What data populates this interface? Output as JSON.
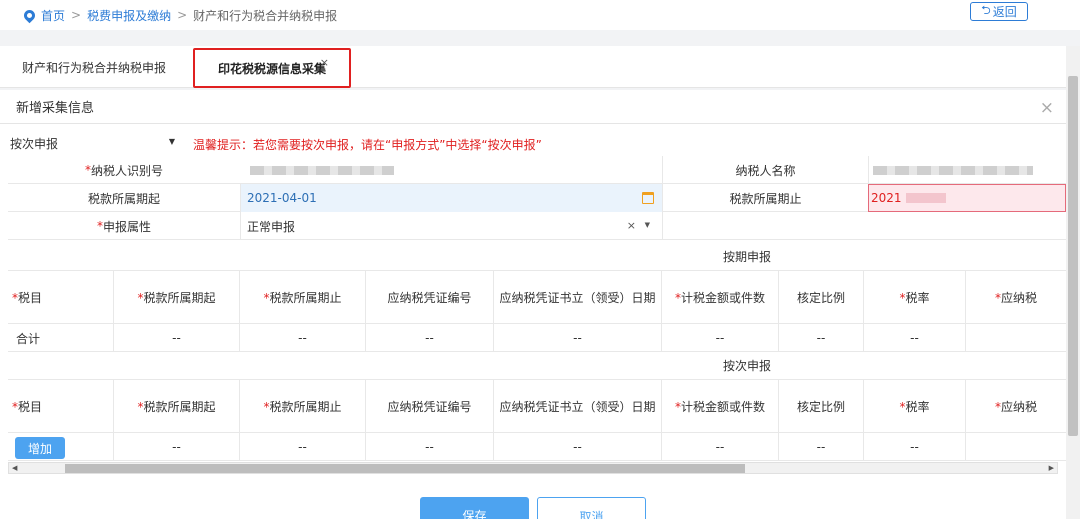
{
  "breadcrumb": {
    "home": "首页",
    "level2": "税费申报及缴纳",
    "current": "财产和行为税合并纳税申报",
    "separator": ">"
  },
  "back_button": "返回",
  "tabs": [
    {
      "label": "财产和行为税合并纳税申报",
      "active": false
    },
    {
      "label": "印花税税源信息采集",
      "active": true,
      "close": "×"
    }
  ],
  "panel": {
    "title": "新增采集信息",
    "close": "×"
  },
  "declare_mode": {
    "selected": "按次申报",
    "tip": "温馨提示：若您需要按次申报，请在“申报方式”中选择“按次申报”"
  },
  "form": {
    "taxpayer_id_label": "纳税人识别号",
    "taxpayer_name_label": "纳税人名称",
    "period_start_label": "税款所属期起",
    "period_start_value": "2021-04-01",
    "period_end_label": "税款所属期止",
    "period_end_value": "2021",
    "attribute_label": "申报属性",
    "attribute_value": "正常申报",
    "clear": "×",
    "required_mark": "*"
  },
  "section_periodic": {
    "title": "按期申报",
    "total_label": "合计",
    "empty": "--"
  },
  "section_once": {
    "title": "按次申报",
    "add_button": "增加",
    "empty": "--"
  },
  "columns": [
    {
      "label": "税目",
      "required": true
    },
    {
      "label": "税款所属期起",
      "required": true
    },
    {
      "label": "税款所属期止",
      "required": true
    },
    {
      "label": "应纳税凭证编号",
      "required": false
    },
    {
      "label": "应纳税凭证书立（领受）日期",
      "required": false
    },
    {
      "label": "计税金额或件数",
      "required": true
    },
    {
      "label": "核定比例",
      "required": false
    },
    {
      "label": "税率",
      "required": true
    },
    {
      "label": "应纳税",
      "required": true
    }
  ],
  "footer": {
    "save": "保存",
    "cancel": "取消"
  }
}
